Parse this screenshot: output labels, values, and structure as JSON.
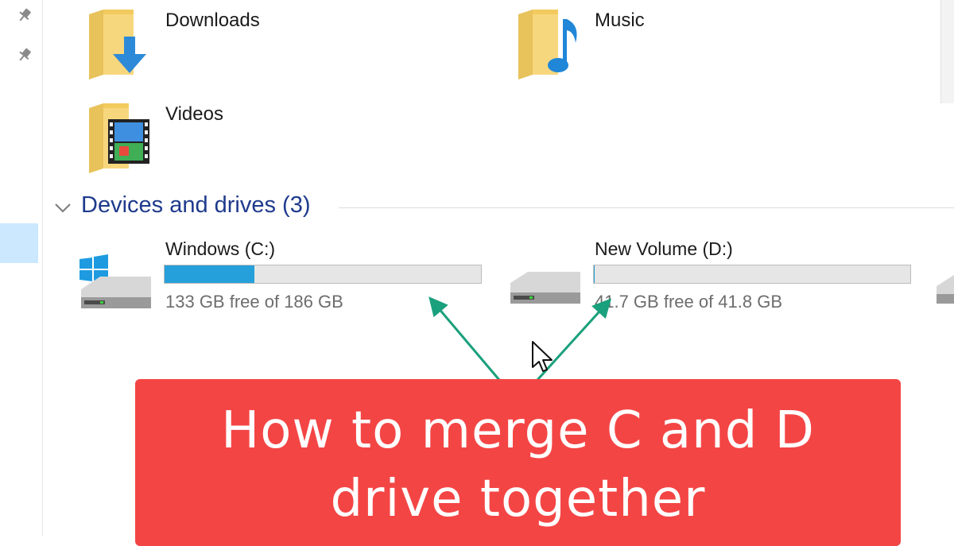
{
  "folders": {
    "downloads": "Downloads",
    "music": "Music",
    "videos": "Videos"
  },
  "devices": {
    "header": "Devices and drives (3)",
    "drives": [
      {
        "name": "Windows (C:)",
        "free_text": "133 GB free of 186 GB",
        "used_fraction": 0.285
      },
      {
        "name": "New Volume (D:)",
        "free_text": "41.7 GB free of 41.8 GB",
        "used_fraction": 0.002
      }
    ]
  },
  "banner": {
    "line1": "How to merge C and D",
    "line2": "drive together",
    "color": "#f44545"
  },
  "colors": {
    "arrow": "#1aa07c",
    "header_text": "#1e3a8c",
    "drive_bar_fill": "#26a0da"
  }
}
